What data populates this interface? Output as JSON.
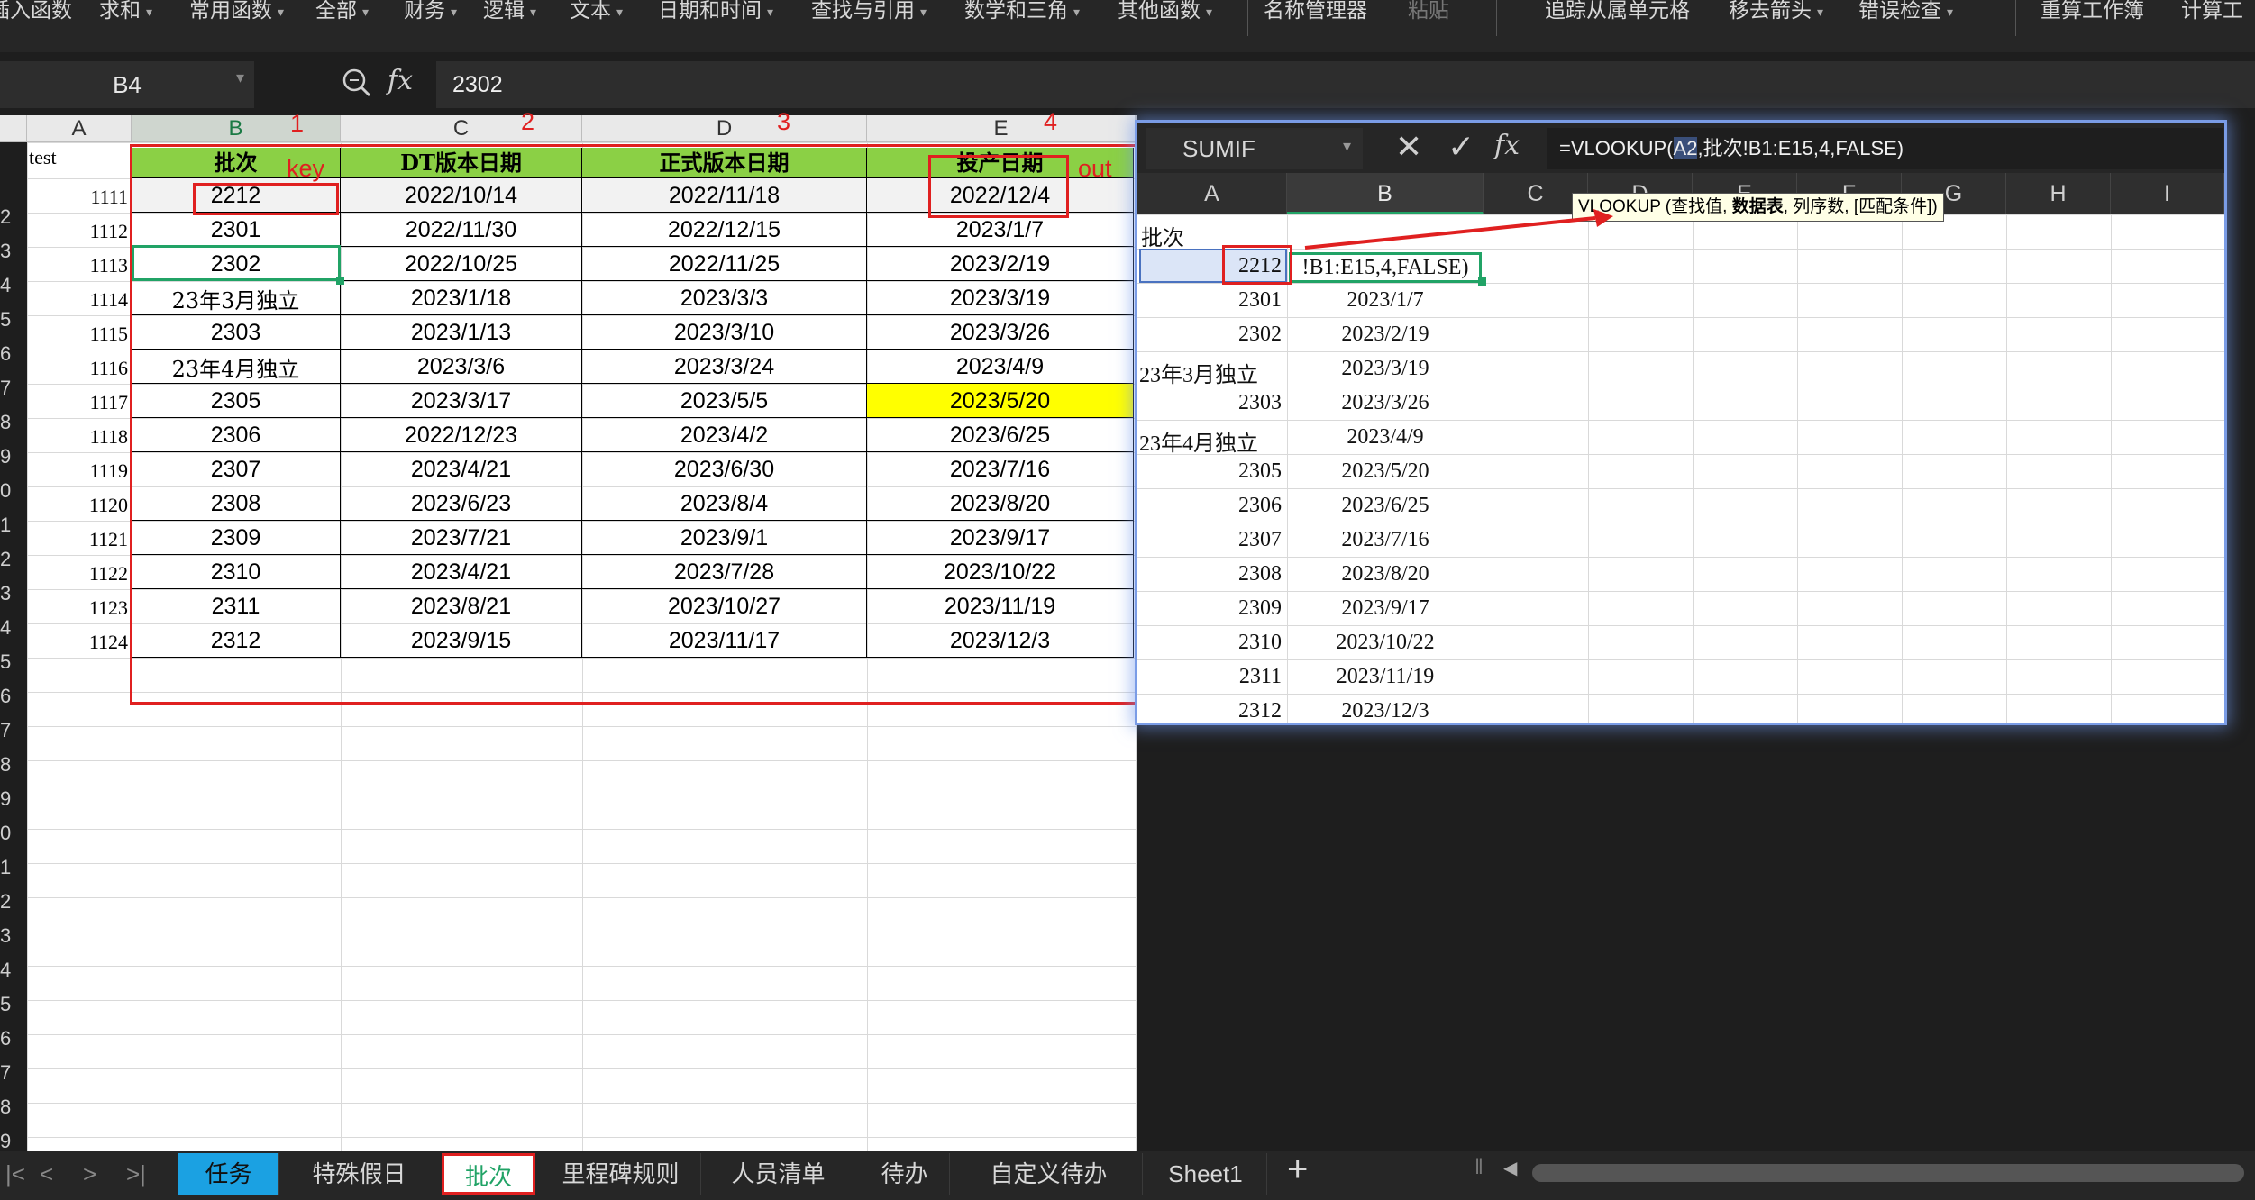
{
  "ribbon": {
    "items": [
      "插入函数",
      "求和",
      "常用函数",
      "全部",
      "财务",
      "逻辑",
      "文本",
      "日期和时间",
      "查找与引用",
      "数学和三角",
      "其他函数",
      "名称管理器",
      "粘贴",
      "追踪从属单元格",
      "移去箭头",
      "错误检查",
      "重算工作簿",
      "计算工"
    ]
  },
  "formula_bar": {
    "name_box": "B4",
    "fx": "fx",
    "formula": "2302"
  },
  "sheet": {
    "col_headers": [
      "A",
      "B",
      "C",
      "D",
      "E"
    ],
    "header_row": [
      "批次",
      "DT版本日期",
      "正式版本日期",
      "投产日期"
    ],
    "a1": "test",
    "a_values": [
      "1111",
      "1112",
      "1113",
      "1114",
      "1115",
      "1116",
      "1117",
      "1118",
      "1119",
      "1120",
      "1121",
      "1122",
      "1123",
      "1124"
    ],
    "row_numbers": [
      "2",
      "3",
      "4",
      "5",
      "6",
      "7",
      "8",
      "9",
      "0",
      "1",
      "2",
      "3",
      "4",
      "5",
      "6",
      "7",
      "8",
      "9",
      "0",
      "1",
      "2",
      "3",
      "4",
      "5",
      "6",
      "7",
      "8",
      "9"
    ],
    "rows": [
      [
        "2212",
        "2022/10/14",
        "2022/11/18",
        "2022/12/4"
      ],
      [
        "2301",
        "2022/11/30",
        "2022/12/15",
        "2023/1/7"
      ],
      [
        "2302",
        "2022/10/25",
        "2022/11/25",
        "2023/2/19"
      ],
      [
        "23年3月独立",
        "2023/1/18",
        "2023/3/3",
        "2023/3/19"
      ],
      [
        "2303",
        "2023/1/13",
        "2023/3/10",
        "2023/3/26"
      ],
      [
        "23年4月独立",
        "2023/3/6",
        "2023/3/24",
        "2023/4/9"
      ],
      [
        "2305",
        "2023/3/17",
        "2023/5/5",
        "2023/5/20"
      ],
      [
        "2306",
        "2022/12/23",
        "2023/4/2",
        "2023/6/25"
      ],
      [
        "2307",
        "2023/4/21",
        "2023/6/30",
        "2023/7/16"
      ],
      [
        "2308",
        "2023/6/23",
        "2023/8/4",
        "2023/8/20"
      ],
      [
        "2309",
        "2023/7/21",
        "2023/9/1",
        "2023/9/17"
      ],
      [
        "2310",
        "2023/4/21",
        "2023/7/28",
        "2023/10/22"
      ],
      [
        "2311",
        "2023/8/21",
        "2023/10/27",
        "2023/11/19"
      ],
      [
        "2312",
        "2023/9/15",
        "2023/11/17",
        "2023/12/3"
      ]
    ],
    "annotations": {
      "n1": "1",
      "n2": "2",
      "n3": "3",
      "n4": "4",
      "key": "key",
      "out": "out"
    },
    "colors": {
      "header_green": "#8bd045",
      "highlight_yellow": "#ffff00",
      "annotation_red": "#e02020",
      "selection_green": "#21a366"
    }
  },
  "popup": {
    "name_box": "SUMIF",
    "formula_prefix": "=VLOOKUP(",
    "formula_ref": "A2",
    "formula_suffix": ",批次!B1:E15,4,FALSE)",
    "tooltip_fn": "VLOOKUP",
    "tooltip_a": "查找值, ",
    "tooltip_bold": "数据表",
    "tooltip_b": ", 列序数, [匹配条件])",
    "col_headers": [
      "A",
      "B",
      "C",
      "D",
      "E",
      "F",
      "G",
      "H",
      "I"
    ],
    "a1": "批次",
    "editing_cell": "!B1:E15,4,FALSE)",
    "a_values": [
      "2212",
      "2301",
      "2302",
      "23年3月独立",
      "2303",
      "23年4月独立",
      "2305",
      "2306",
      "2307",
      "2308",
      "2309",
      "2310",
      "2311",
      "2312"
    ],
    "b_values": [
      "",
      "2023/1/7",
      "2023/2/19",
      "2023/3/19",
      "2023/3/26",
      "2023/4/9",
      "2023/5/20",
      "2023/6/25",
      "2023/7/16",
      "2023/8/20",
      "2023/9/17",
      "2023/10/22",
      "2023/11/19",
      "2023/12/3"
    ]
  },
  "tabs": [
    "任务",
    "特殊假日",
    "批次",
    "里程碑规则",
    "人员清单",
    "待办",
    "自定义待办",
    "Sheet1"
  ]
}
